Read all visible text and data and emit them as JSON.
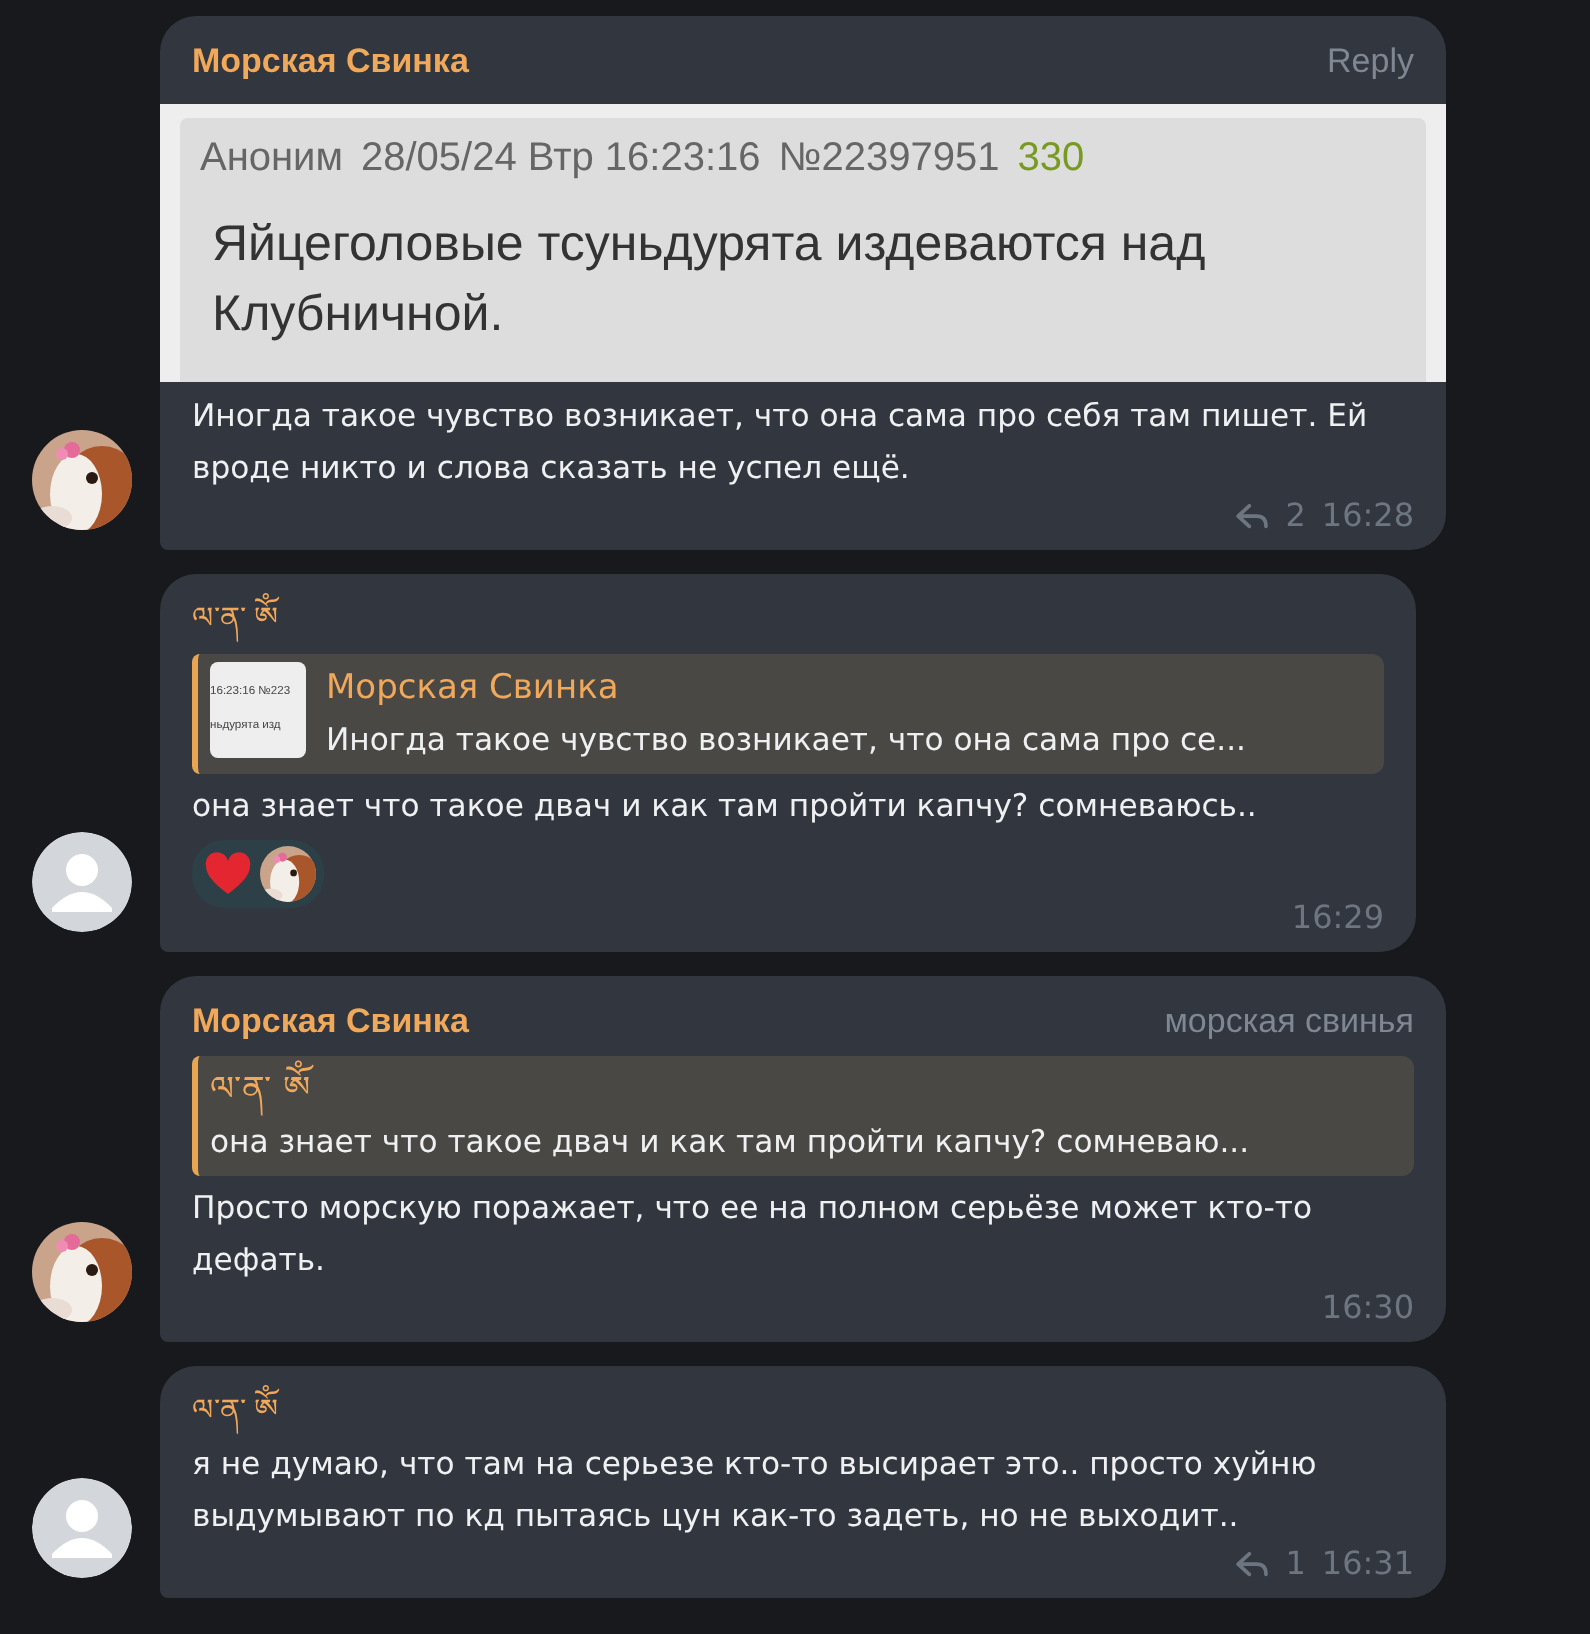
{
  "messages": [
    {
      "kind": "preview",
      "avatar": {
        "kind": "picture"
      },
      "author": "Морская Свинка",
      "header_right": "Reply",
      "preview": {
        "poster": "Аноним",
        "date": "28/05/24 Втр 16:23:16",
        "number": "№22397951",
        "count": "330",
        "body": "Яйцеголовые тсуньдурята издеваются над Клубничной."
      },
      "text": "Иногда такое чувство возникает, что она сама про себя там пишет. Ей вроде никто и слова сказать не успел ещё.",
      "replies": "2",
      "time": "16:28"
    },
    {
      "kind": "quote",
      "avatar": {
        "kind": "placeholder"
      },
      "author": "ལ་ན་ ༀ",
      "quote": {
        "thumb_lines": [
          "16:23:16 №223",
          "ньдурята изд"
        ],
        "author": "Морская Свинка",
        "text": "Иногда такое чувство возникает, что она сама про се..."
      },
      "text": "она знает что такое двач и как там пройти капчу? сомневаюсь..",
      "reactions": [
        {
          "kind": "heart"
        },
        {
          "kind": "picture"
        }
      ],
      "time": "16:29"
    },
    {
      "kind": "quote",
      "avatar": {
        "kind": "picture"
      },
      "author": "Морская Свинка",
      "header_right": "морская свинья",
      "quote": {
        "author": "ལ་ན་ ༀ",
        "text": "она знает что такое двач и как там пройти капчу? сомневаю..."
      },
      "text": "Просто морскую поражает, что ее на полном серьёзе может кто-то дефать.",
      "time": "16:30"
    },
    {
      "kind": "plain",
      "avatar": {
        "kind": "placeholder"
      },
      "author": "ལ་ན་ ༀ",
      "text": "я не думаю, что там на серьезе кто-то высирает это.. просто хуйню выдумывают по кд пытаясь цун как-то задеть, но не выходит..",
      "replies": "1",
      "time": "16:31"
    }
  ]
}
